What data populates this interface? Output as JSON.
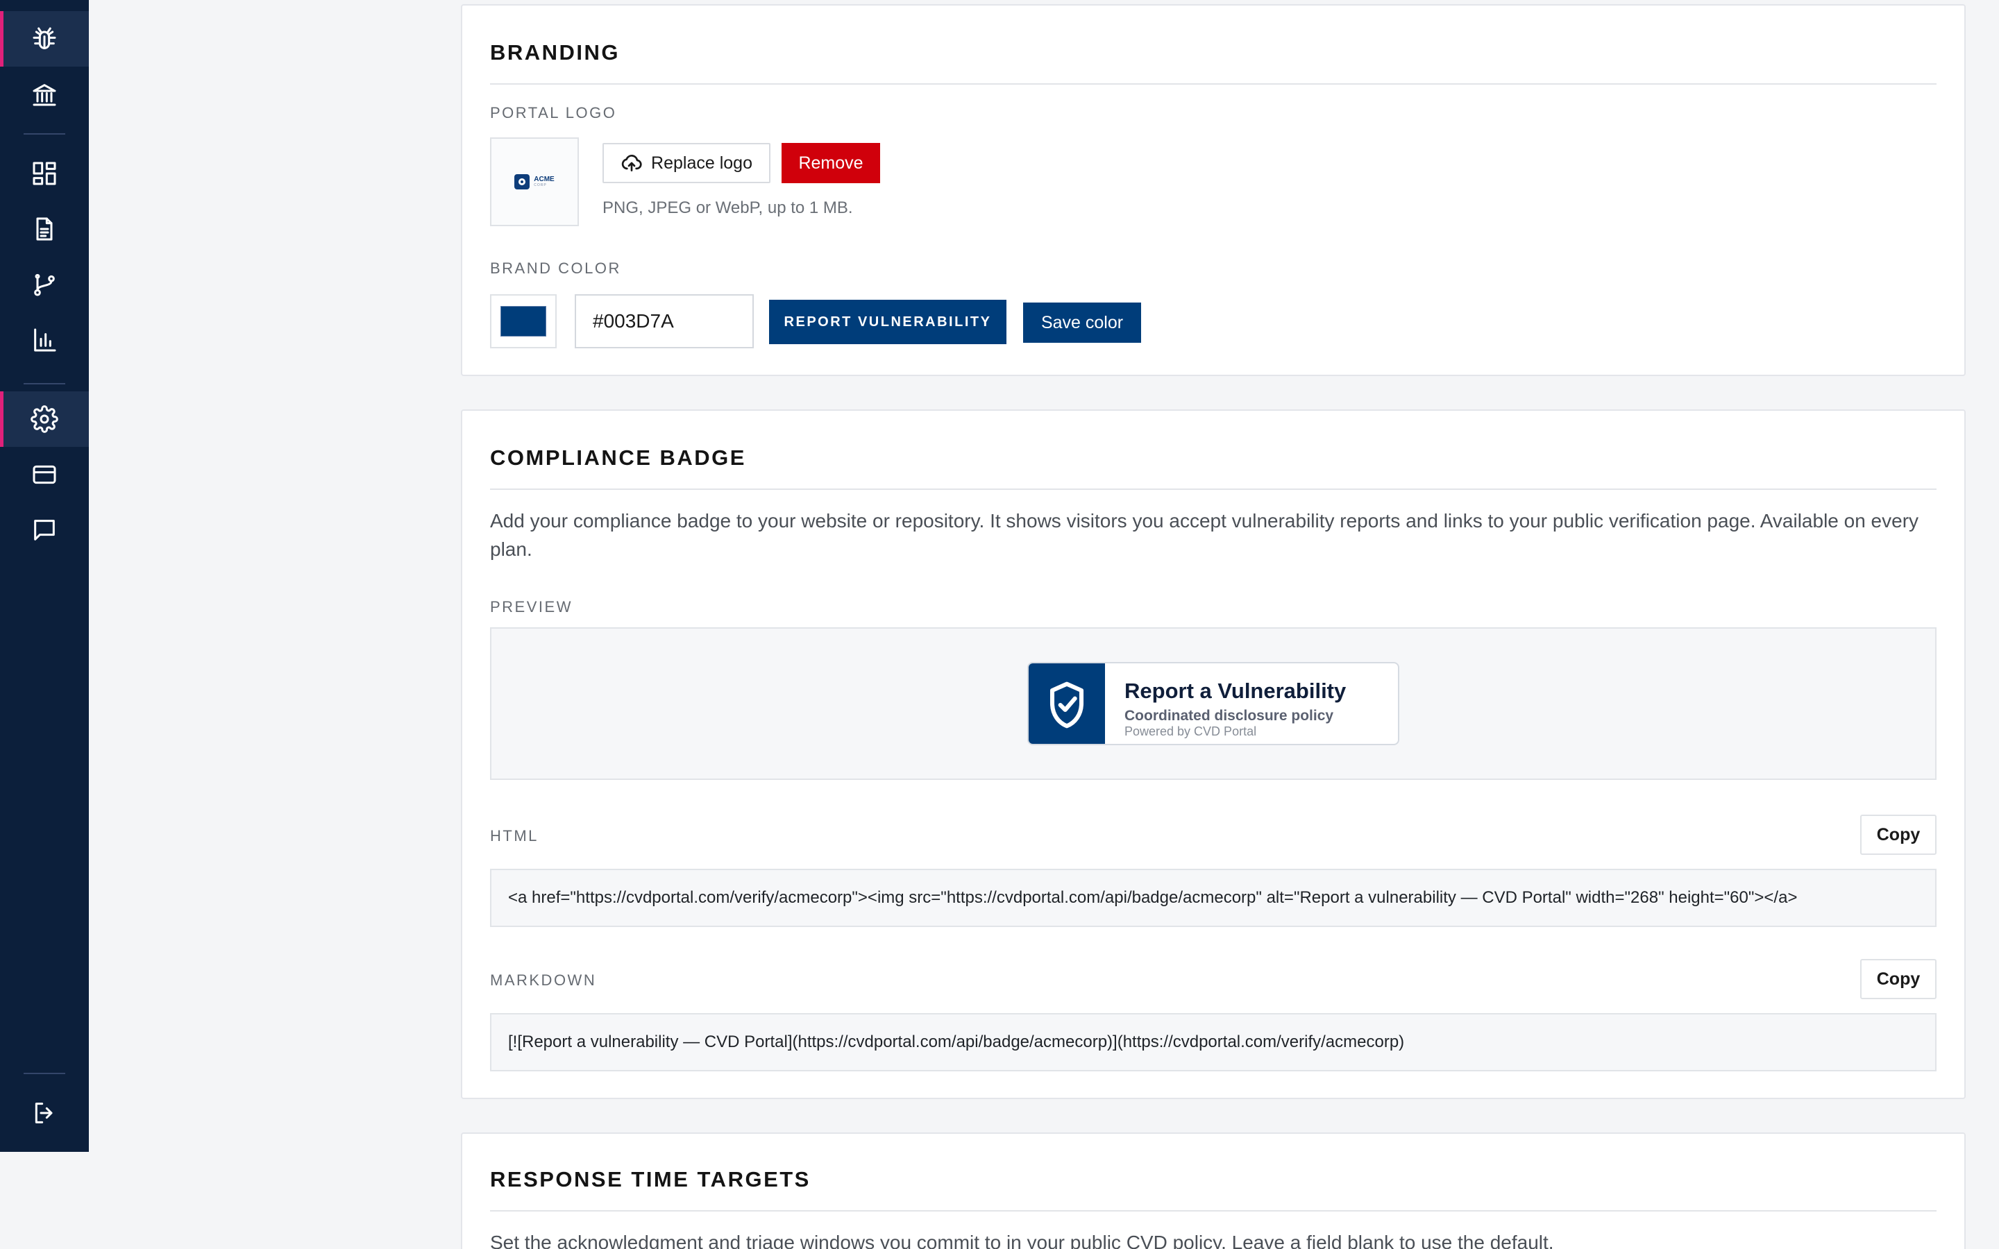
{
  "sidebar": {
    "items": [
      {
        "icon": "bug-icon",
        "active": true
      },
      {
        "icon": "bank-icon",
        "active": false
      },
      {
        "icon": "dashboard-icon",
        "active": false
      },
      {
        "icon": "document-icon",
        "active": false
      },
      {
        "icon": "git-branch-icon",
        "active": false
      },
      {
        "icon": "bar-chart-icon",
        "active": false
      },
      {
        "icon": "gear-icon",
        "active": true
      },
      {
        "icon": "credit-card-icon",
        "active": false
      },
      {
        "icon": "chat-icon",
        "active": false
      }
    ],
    "logout_icon": "logout-icon"
  },
  "branding": {
    "title": "BRANDING",
    "portal_logo_label": "PORTAL LOGO",
    "logo_text": "ACME",
    "logo_subtext": "CORP",
    "replace_logo_label": "Replace logo",
    "remove_label": "Remove",
    "logo_hint": "PNG, JPEG or WebP, up to 1 MB.",
    "brand_color_label": "BRAND COLOR",
    "brand_color_value": "#003D7A",
    "preview_button_label": "REPORT VULNERABILITY",
    "save_color_label": "Save color"
  },
  "compliance": {
    "title": "COMPLIANCE BADGE",
    "description": "Add your compliance badge to your website or repository. It shows visitors you accept vulnerability reports and links to your public verification page. Available on every plan.",
    "preview_label": "PREVIEW",
    "badge": {
      "title": "Report a Vulnerability",
      "subtitle": "Coordinated disclosure policy",
      "powered": "Powered by CVD Portal"
    },
    "html_label": "HTML",
    "html_copy_label": "Copy",
    "html_code": "<a href=\"https://cvdportal.com/verify/acmecorp\"><img src=\"https://cvdportal.com/api/badge/acmecorp\" alt=\"Report a vulnerability — CVD Portal\" width=\"268\" height=\"60\"></a>",
    "markdown_label": "MARKDOWN",
    "markdown_copy_label": "Copy",
    "markdown_code": "[![Report a vulnerability — CVD Portal](https://cvdportal.com/api/badge/acmecorp)](https://cvdportal.com/verify/acmecorp)"
  },
  "response": {
    "title": "RESPONSE TIME TARGETS",
    "description": "Set the acknowledgment and triage windows you commit to in your public CVD policy. Leave a field blank to use the default."
  },
  "colors": {
    "sidebar_bg": "#0c1f3b",
    "accent": "#e0217a",
    "brand": "#003d7a",
    "danger": "#d0000b"
  }
}
